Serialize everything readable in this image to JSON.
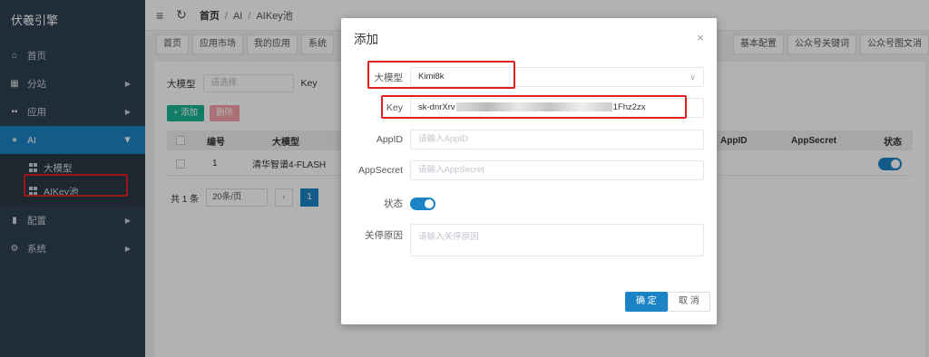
{
  "app": {
    "title": "伏羲引擎"
  },
  "sidebar": {
    "items": [
      {
        "label": "首页",
        "icon": "home-icon"
      },
      {
        "label": "分站",
        "icon": "building-icon"
      },
      {
        "label": "应用",
        "icon": "grid-icon"
      },
      {
        "label": "AI",
        "icon": "bulb-icon"
      },
      {
        "label": "配置",
        "icon": "bar-chart-icon"
      },
      {
        "label": "系统",
        "icon": "gear-icon"
      }
    ],
    "ai_sub": [
      {
        "label": "大模型"
      },
      {
        "label": "AIKey池"
      }
    ]
  },
  "breadcrumb": {
    "home": "首页",
    "level1": "AI",
    "level2": "AIKey池"
  },
  "tabs": {
    "left": [
      "首页",
      "应用市场",
      "我的应用",
      "系统"
    ],
    "right": [
      "基本配置",
      "公众号关键词",
      "公众号图文消"
    ]
  },
  "filter": {
    "model_label": "大模型",
    "model_placeholder": "请选择",
    "key_label": "Key"
  },
  "toolbar": {
    "add": "+ 添加",
    "delete": "删除"
  },
  "table": {
    "headers": {
      "no": "编号",
      "model": "大模型",
      "appid": "AppID",
      "appsecret": "AppSecret",
      "status": "状态"
    },
    "rows": [
      {
        "no": "1",
        "model": "清华智谱4-FLASH",
        "status": true
      }
    ]
  },
  "pager": {
    "total": "共 1 条",
    "size": "20条/页",
    "page": "1"
  },
  "modal": {
    "title": "添加",
    "close": "×",
    "model_label": "大模型",
    "model_value": "Kimi8k",
    "key_label": "Key",
    "key_prefix": "sk-dnrXrv",
    "key_suffix": "1Fhz2zx",
    "appid_label": "AppID",
    "appid_placeholder": "请输入AppID",
    "appsecret_label": "AppSecret",
    "appsecret_placeholder": "请输入AppSecret",
    "status_label": "状态",
    "status_on": true,
    "reason_label": "关停原因",
    "reason_placeholder": "请输入关停原因",
    "ok": "确 定",
    "cancel": "取 消"
  },
  "colors": {
    "sidebar_bg": "#2f4050",
    "active": "#1c84c6",
    "highlight": "#e02020",
    "add": "#1ab394",
    "delete": "#ed5565"
  }
}
